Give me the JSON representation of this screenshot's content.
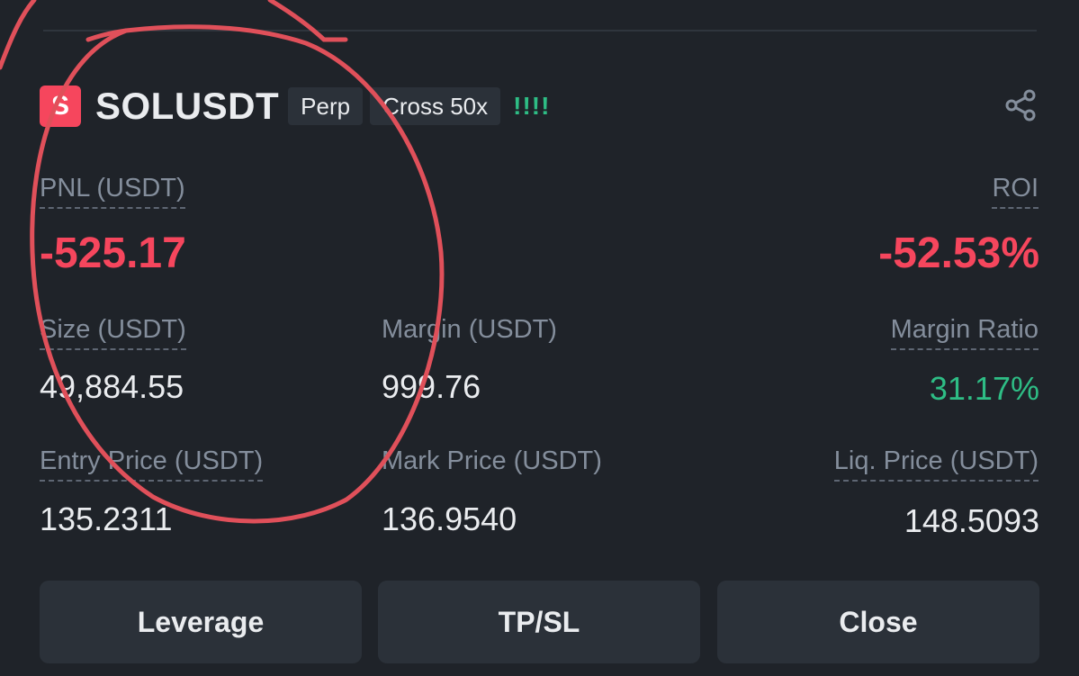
{
  "position": {
    "symbol_icon_letter": "S",
    "symbol": "SOLUSDT",
    "type_tag": "Perp",
    "margin_tag": "Cross 50x",
    "alert_marks": "!!!!"
  },
  "metrics": {
    "pnl_label": "PNL (USDT)",
    "pnl_value": "-525.17",
    "roi_label": "ROI",
    "roi_value": "-52.53%",
    "size_label": "Size (USDT)",
    "size_value": "49,884.55",
    "margin_label": "Margin (USDT)",
    "margin_value": "999.76",
    "margin_ratio_label": "Margin Ratio",
    "margin_ratio_value": "31.17%",
    "entry_price_label": "Entry Price (USDT)",
    "entry_price_value": "135.2311",
    "mark_price_label": "Mark Price (USDT)",
    "mark_price_value": "136.9540",
    "liq_price_label": "Liq. Price (USDT)",
    "liq_price_value": "148.5093"
  },
  "actions": {
    "leverage_label": "Leverage",
    "tpsl_label": "TP/SL",
    "close_label": "Close"
  },
  "icons": {
    "share": "share-icon"
  },
  "colors": {
    "background": "#1f2329",
    "loss_red": "#f6465d",
    "profit_green": "#2ebd85",
    "annotation_red": "#e0505a"
  }
}
